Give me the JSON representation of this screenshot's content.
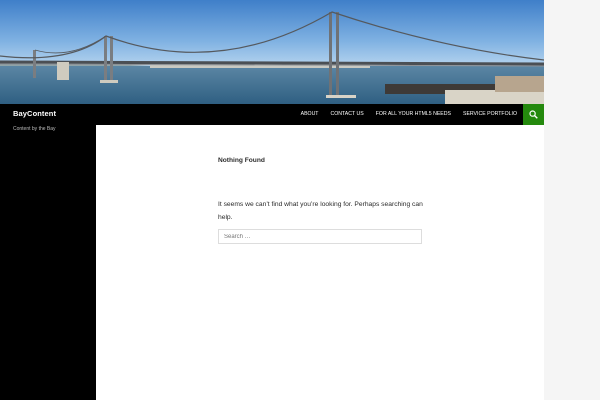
{
  "site": {
    "title": "BayContent",
    "tagline": "Content by the Bay"
  },
  "nav": {
    "items": [
      {
        "label": "ABOUT"
      },
      {
        "label": "CONTACT US"
      },
      {
        "label": "FOR ALL YOUR HTML5 NEEDS"
      },
      {
        "label": "SERVICE PORTFOLIO"
      }
    ],
    "search_icon": "search-icon"
  },
  "content": {
    "title": "Nothing Found",
    "message": "It seems we can’t find what you’re looking for. Perhaps searching can help.",
    "search_placeholder": "Search …"
  },
  "colors": {
    "accent": "#24890d",
    "header_bg": "#000000",
    "page_bg": "#ffffff",
    "outer_bg": "#f5f5f5"
  }
}
